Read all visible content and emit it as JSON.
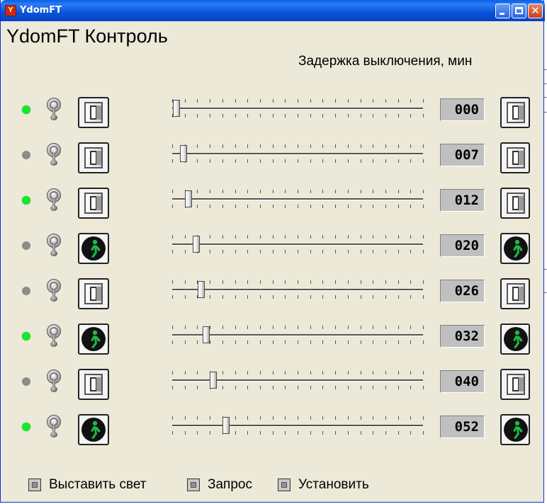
{
  "window": {
    "title": "YdomFT",
    "app_icon_glyph": "Y",
    "controls": [
      "minimize-button",
      "maximize-button",
      "close-button"
    ]
  },
  "heading": "YdomFT Контроль",
  "delay_label": "Задержка выключения, мин",
  "colors": {
    "led_on": "#17e82c",
    "led_off": "#8c8c8c",
    "window_bg": "#ece9d8",
    "titlebar": "#0853d8"
  },
  "rows": [
    {
      "led": "on",
      "state_icon": "light-switch-icon",
      "delay_value": "000",
      "slider_fraction": 0.017,
      "set_icon": "light-switch-icon"
    },
    {
      "led": "off",
      "state_icon": "light-switch-icon",
      "delay_value": "007",
      "slider_fraction": 0.045,
      "set_icon": "light-switch-icon"
    },
    {
      "led": "on",
      "state_icon": "light-switch-icon",
      "delay_value": "012",
      "slider_fraction": 0.065,
      "set_icon": "light-switch-icon"
    },
    {
      "led": "off",
      "state_icon": "pedestrian-icon",
      "delay_value": "020",
      "slider_fraction": 0.095,
      "set_icon": "pedestrian-icon"
    },
    {
      "led": "off",
      "state_icon": "light-switch-icon",
      "delay_value": "026",
      "slider_fraction": 0.115,
      "set_icon": "light-switch-icon"
    },
    {
      "led": "on",
      "state_icon": "pedestrian-icon",
      "delay_value": "032",
      "slider_fraction": 0.137,
      "set_icon": "pedestrian-icon"
    },
    {
      "led": "off",
      "state_icon": "light-switch-icon",
      "delay_value": "040",
      "slider_fraction": 0.165,
      "set_icon": "light-switch-icon"
    },
    {
      "led": "on",
      "state_icon": "pedestrian-icon",
      "delay_value": "052",
      "slider_fraction": 0.214,
      "set_icon": "pedestrian-icon"
    }
  ],
  "buttons": {
    "set_light": "Выставить свет",
    "request": "Запрос",
    "install": "Установить"
  }
}
